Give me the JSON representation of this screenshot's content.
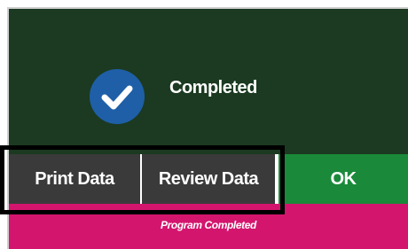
{
  "status": {
    "title": "Completed",
    "icon": "check-icon"
  },
  "buttons": {
    "print_label": "Print Data",
    "review_label": "Review Data",
    "ok_label": "OK"
  },
  "status_bar": {
    "message": "Program Completed"
  },
  "colors": {
    "panel": "#1b3a21",
    "check_circle": "#1f5fa8",
    "button_dark": "#3a3a3a",
    "button_ok": "#1a8a3a",
    "status_bar": "#d4156e",
    "highlight": "#000000"
  }
}
